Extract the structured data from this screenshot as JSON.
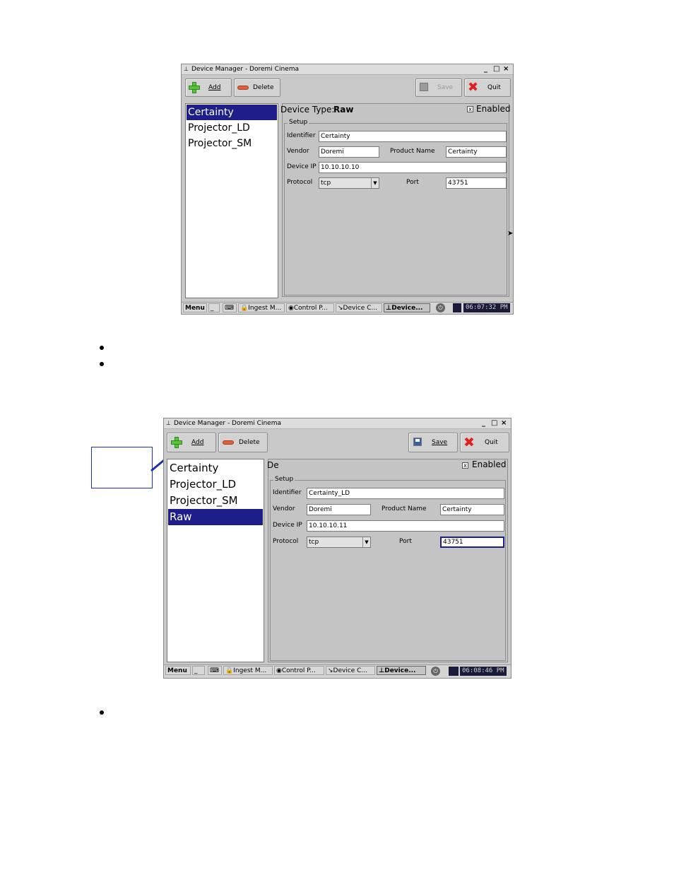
{
  "screen1": {
    "title": "Device Manager - Doremi Cinema",
    "window_controls": [
      "_",
      "□",
      "×"
    ],
    "toolbar": {
      "add": "Add",
      "delete": "Delete",
      "save": "Save",
      "quit": "Quit",
      "save_enabled": false
    },
    "devices": [
      "Certainty",
      "Projector_LD",
      "Projector_SM"
    ],
    "selected_index": 0,
    "device_type_label": "Device Type:",
    "device_type_value": "Raw",
    "enabled_label": "Enabled",
    "enabled_checked": true,
    "setup_legend": "Setup",
    "fields": {
      "identifier_label": "Identifier",
      "identifier": "Certainty",
      "vendor_label": "Vendor",
      "vendor": "Doremi",
      "product_name_label": "Product Name",
      "product_name": "Certainty",
      "device_ip_label": "Device IP",
      "device_ip": "10.10.10.10",
      "protocol_label": "Protocol",
      "protocol": "tcp",
      "port_label": "Port",
      "port": "43751"
    },
    "taskbar": {
      "menu": "Menu",
      "items": [
        "Ingest M...",
        "Control P...",
        "Device C...",
        "Device..."
      ],
      "active_index": 3,
      "clock": "06:07:32 PM"
    }
  },
  "screen2": {
    "title": "Device Manager - Doremi Cinema",
    "window_controls": [
      "_",
      "□",
      "×"
    ],
    "toolbar": {
      "add": "Add",
      "delete": "Delete",
      "save": "Save",
      "quit": "Quit",
      "save_enabled": true
    },
    "devices": [
      "Certainty",
      "Projector_LD",
      "Projector_SM",
      "Raw"
    ],
    "selected_index": 3,
    "device_type_partial": "De",
    "enabled_label": "Enabled",
    "enabled_checked": true,
    "setup_legend": "Setup",
    "fields": {
      "identifier_label": "Identifier",
      "identifier": "Certainty_LD",
      "vendor_label": "Vendor",
      "vendor": "Doremi",
      "product_name_label": "Product Name",
      "product_name": "Certainty",
      "device_ip_label": "Device IP",
      "device_ip": "10.10.10.11",
      "protocol_label": "Protocol",
      "protocol": "tcp",
      "port_label": "Port",
      "port": "43751"
    },
    "taskbar": {
      "menu": "Menu",
      "items": [
        "Ingest M...",
        "Control P...",
        "Device C...",
        "Device..."
      ],
      "active_index": 3,
      "clock": "06:08:46 PM"
    }
  },
  "colors": {
    "selection": "#1e1e8a",
    "callout_border": "#1e2fb0",
    "window_bg": "#c8c8c8"
  }
}
